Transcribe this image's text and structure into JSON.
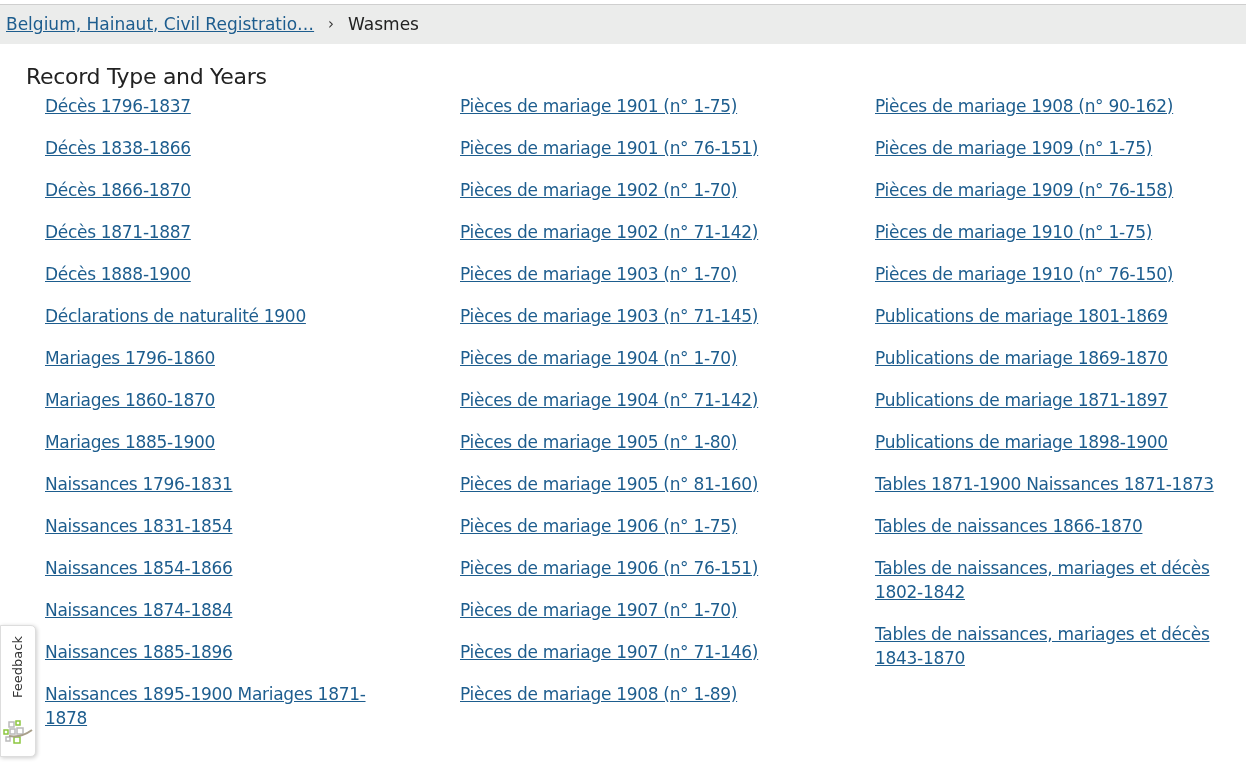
{
  "breadcrumb": {
    "parent": "Belgium, Hainaut, Civil Registratio…",
    "separator": "›",
    "current": "Wasmes"
  },
  "heading": "Record Type and Years",
  "columns": [
    [
      "Décès 1796-1837",
      "Décès 1838-1866",
      "Décès 1866-1870",
      "Décès 1871-1887",
      "Décès 1888-1900",
      "Déclarations de naturalité 1900",
      "Mariages 1796-1860",
      "Mariages 1860-1870",
      "Mariages 1885-1900",
      "Naissances 1796-1831",
      "Naissances 1831-1854",
      "Naissances 1854-1866",
      "Naissances 1874-1884",
      "Naissances 1885-1896",
      "Naissances 1895-1900 Mariages 1871-1878"
    ],
    [
      "Pièces de mariage 1901 (n° 1-75)",
      "Pièces de mariage 1901 (n° 76-151)",
      "Pièces de mariage 1902 (n° 1-70)",
      "Pièces de mariage 1902 (n° 71-142)",
      "Pièces de mariage 1903 (n° 1-70)",
      "Pièces de mariage 1903 (n° 71-145)",
      "Pièces de mariage 1904 (n° 1-70)",
      "Pièces de mariage 1904 (n° 71-142)",
      "Pièces de mariage 1905 (n° 1-80)",
      "Pièces de mariage 1905 (n° 81-160)",
      "Pièces de mariage 1906 (n° 1-75)",
      "Pièces de mariage 1906 (n° 76-151)",
      "Pièces de mariage 1907 (n° 1-70)",
      "Pièces de mariage 1907 (n° 71-146)",
      "Pièces de mariage 1908 (n° 1-89)"
    ],
    [
      "Pièces de mariage 1908 (n° 90-162)",
      "Pièces de mariage 1909 (n° 1-75)",
      "Pièces de mariage 1909 (n° 76-158)",
      "Pièces de mariage 1910 (n° 1-75)",
      "Pièces de mariage 1910 (n° 76-150)",
      "Publications de mariage 1801-1869",
      "Publications de mariage 1869-1870",
      "Publications de mariage 1871-1897",
      "Publications de mariage 1898-1900",
      "Tables 1871-1900 Naissances 1871-1873",
      "Tables de naissances 1866-1870",
      "Tables de naissances, mariages et décès 1802-1842",
      "Tables de naissances, mariages et décès 1843-1870"
    ]
  ],
  "feedback": {
    "label": "Feedback"
  }
}
